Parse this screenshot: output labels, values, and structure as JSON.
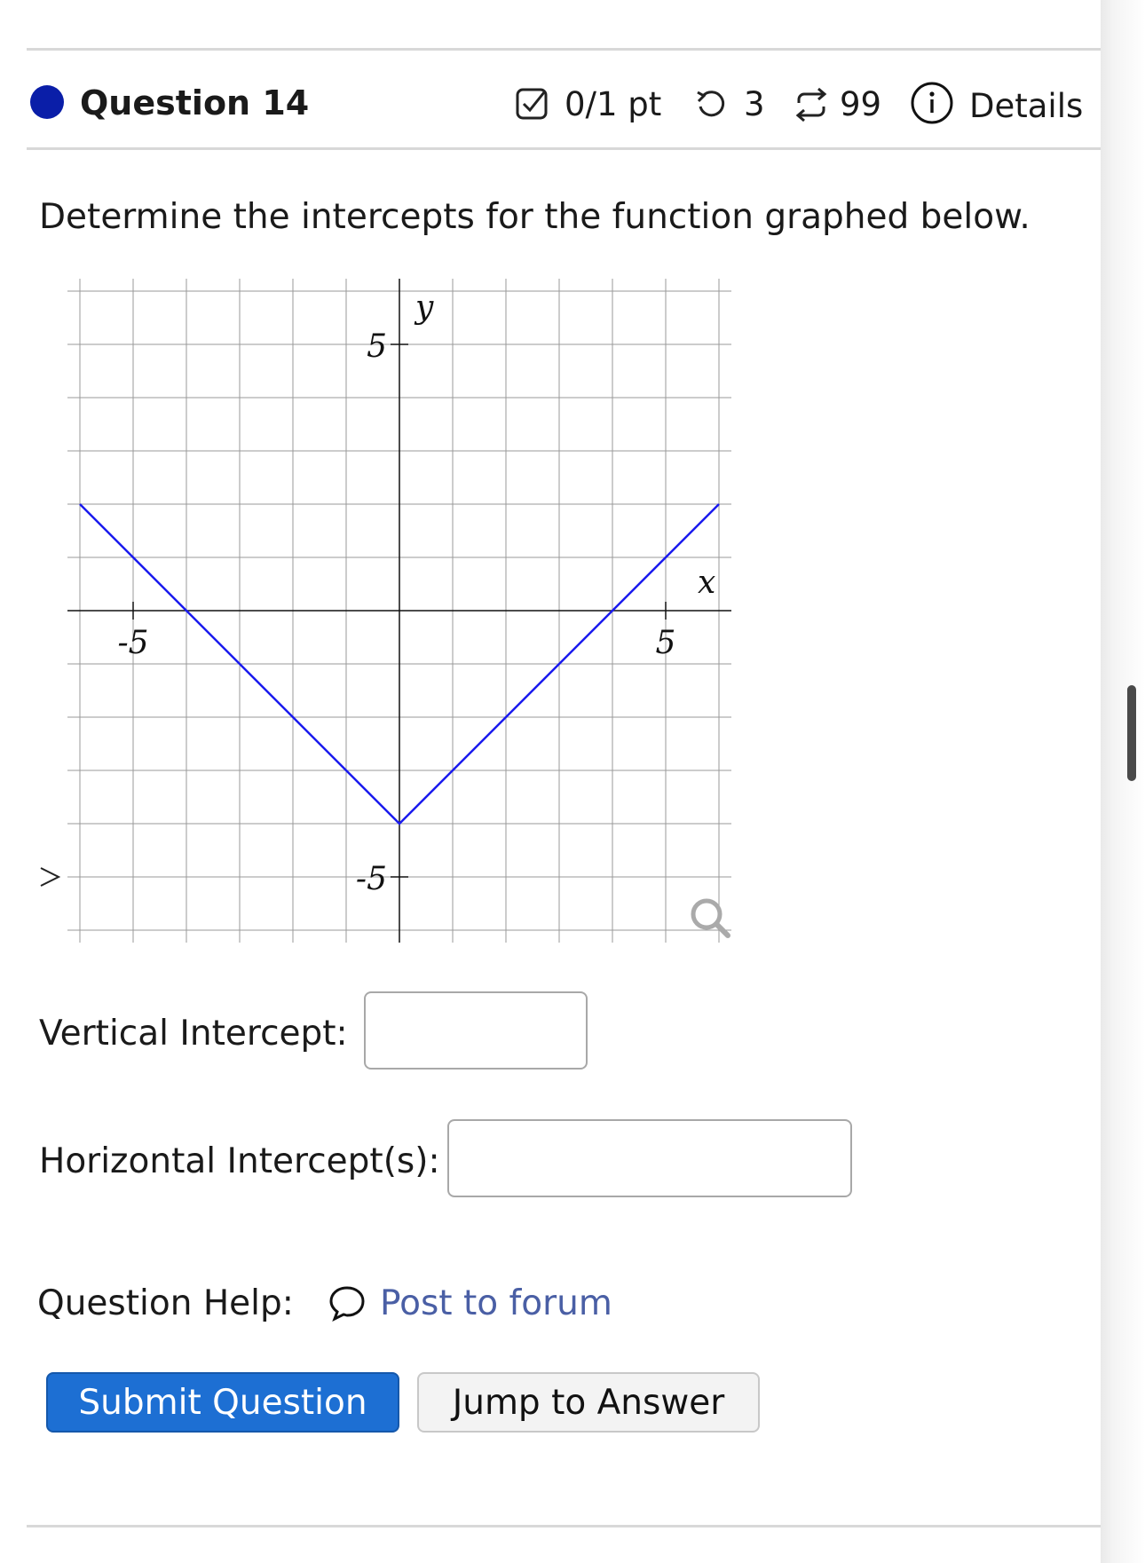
{
  "question": {
    "title": "Question 14",
    "points": "0/1 pt",
    "retries": "3",
    "attempts": "99",
    "details_label": "Details",
    "prompt": "Determine the intercepts for the function graphed below."
  },
  "graph": {
    "axis_label_x": "x",
    "axis_label_y": "y",
    "tick_labels": {
      "x_neg": "-5",
      "x_pos": "5",
      "y_pos": "5",
      "y_neg": "-5"
    },
    "line_color": "#1a1aee",
    "x_range": [
      -6,
      6
    ],
    "y_range": [
      -6,
      6
    ],
    "function_points": [
      [
        -6,
        2
      ],
      [
        0,
        -4
      ],
      [
        6,
        2
      ]
    ]
  },
  "fields": {
    "vertical_label": "Vertical Intercept:",
    "vertical_value": "",
    "horizontal_label": "Horizontal Intercept(s):",
    "horizontal_value": ""
  },
  "help": {
    "label": "Question Help:",
    "link": "Post to forum"
  },
  "buttons": {
    "submit": "Submit Question",
    "jump": "Jump to Answer"
  },
  "colors": {
    "accent": "#1d6fd3",
    "link": "#4a5fa5",
    "dot": "#0a1ea8"
  }
}
